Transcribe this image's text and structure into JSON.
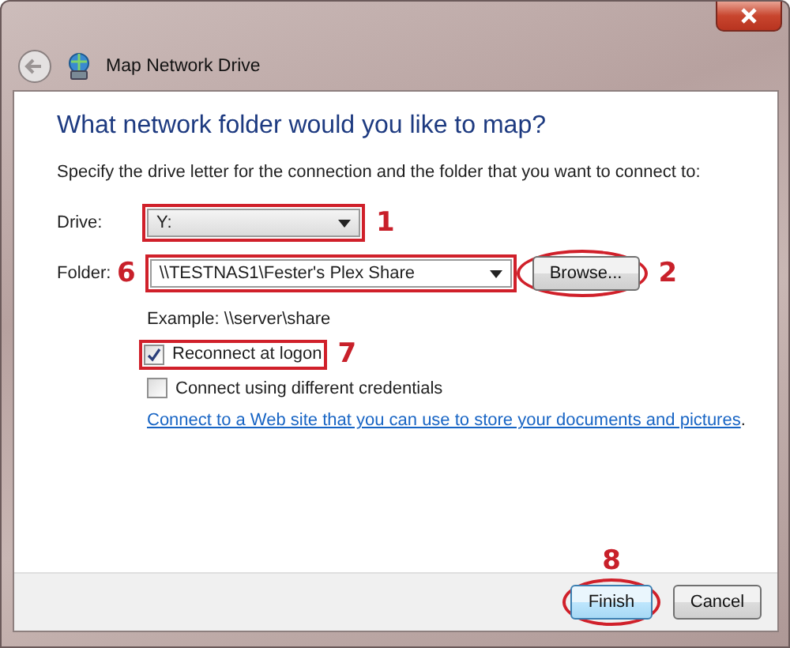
{
  "window": {
    "title": "Map Network Drive"
  },
  "heading": "What network folder would you like to map?",
  "instruction": "Specify the drive letter for the connection and the folder that you want to connect to:",
  "drive": {
    "label": "Drive:",
    "value": "Y:",
    "annotation": {
      "number": "1",
      "kind": "box"
    }
  },
  "folder": {
    "label": "Folder:",
    "value": "\\\\TESTNAS1\\Fester's Plex Share",
    "annotation": {
      "number": "6",
      "kind": "box",
      "number_left": true
    }
  },
  "browse_button": {
    "label": "Browse...",
    "annotation": {
      "number": "2",
      "kind": "ellipse"
    }
  },
  "example": "Example: \\\\server\\share",
  "options": [
    {
      "label": "Reconnect at logon",
      "checked": true,
      "annotation": {
        "number": "7",
        "kind": "box"
      }
    },
    {
      "label": "Connect using different credentials",
      "checked": false
    }
  ],
  "link": "Connect to a Web site that you can use to store your documents and pictures",
  "link_suffix": ".",
  "buttons": [
    {
      "label": "Finish",
      "default": true,
      "annotation": {
        "number": "8",
        "kind": "ellipse",
        "number_above": true
      }
    },
    {
      "label": "Cancel",
      "default": false
    }
  ]
}
